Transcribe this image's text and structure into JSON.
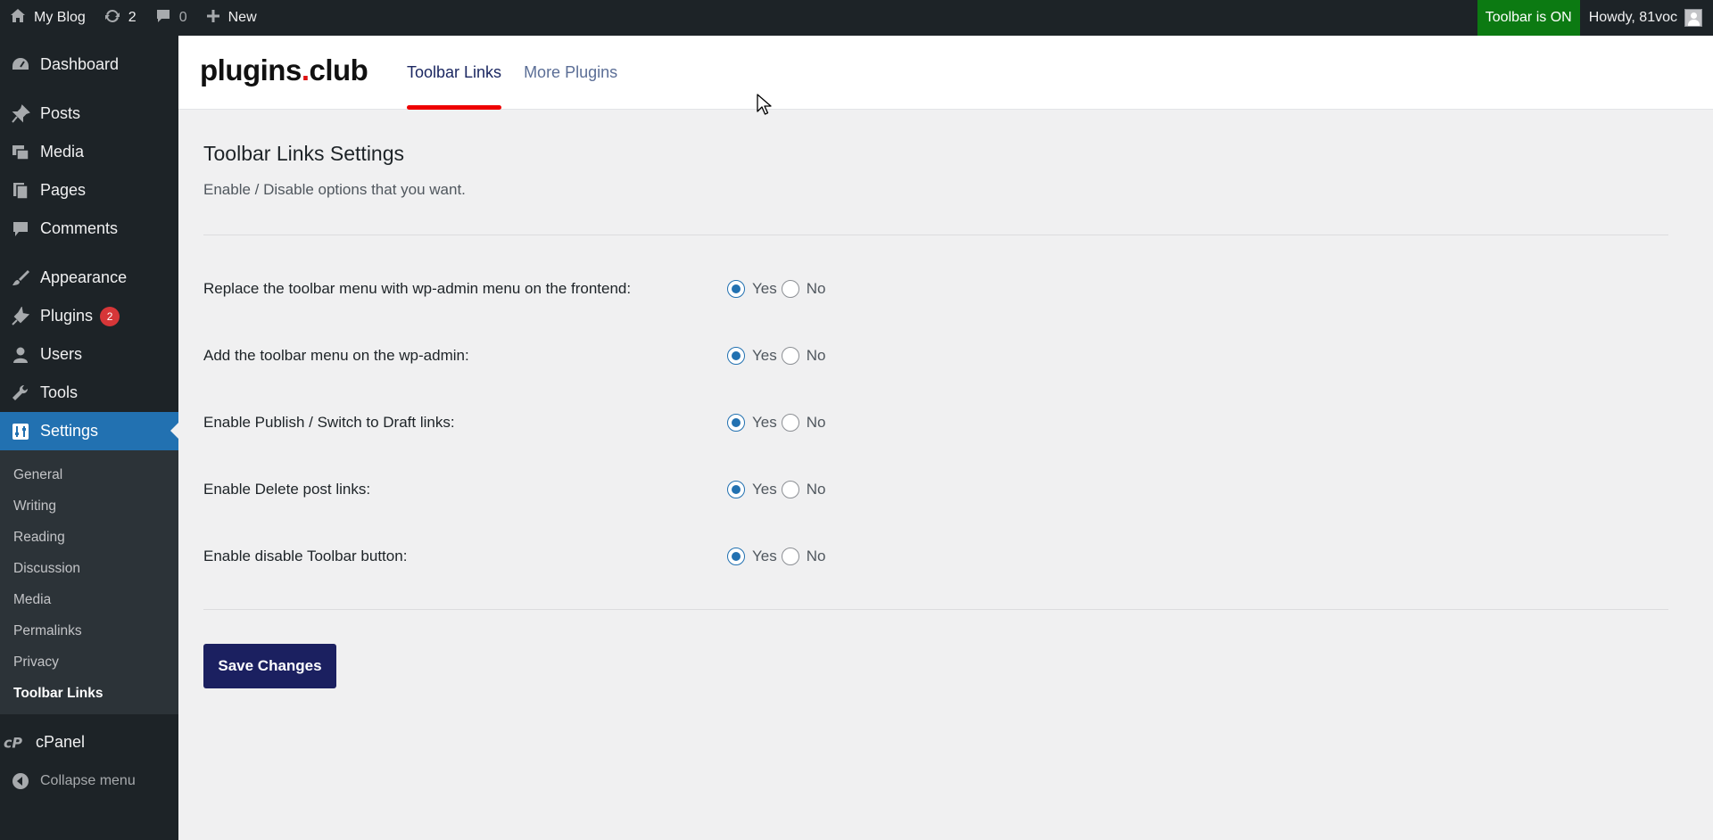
{
  "adminbar": {
    "site_name": "My Blog",
    "updates_count": "2",
    "comments_count": "0",
    "new_label": "New",
    "toolbar_status": "Toolbar is ON",
    "howdy": "Howdy, 81voc",
    "colors": {
      "bg": "#1d2327",
      "toolbar_on": "#0c7a12"
    }
  },
  "sidebar": {
    "items": [
      {
        "label": "Dashboard",
        "icon": "dashboard-icon"
      },
      {
        "label": "Posts",
        "icon": "pin-icon"
      },
      {
        "label": "Media",
        "icon": "media-icon"
      },
      {
        "label": "Pages",
        "icon": "pages-icon"
      },
      {
        "label": "Comments",
        "icon": "comment-icon"
      },
      {
        "label": "Appearance",
        "icon": "brush-icon"
      },
      {
        "label": "Plugins",
        "icon": "plugin-icon",
        "badge": "2"
      },
      {
        "label": "Users",
        "icon": "user-icon"
      },
      {
        "label": "Tools",
        "icon": "wrench-icon"
      },
      {
        "label": "Settings",
        "icon": "settings-icon"
      }
    ],
    "submenu": [
      "General",
      "Writing",
      "Reading",
      "Discussion",
      "Media",
      "Permalinks",
      "Privacy",
      "Toolbar Links"
    ],
    "cpanel": "cPanel",
    "collapse": "Collapse menu",
    "colors": {
      "current": "#2271b1"
    }
  },
  "plugin_header": {
    "logo_text": "plugins",
    "logo_dot": ".",
    "logo_suffix": "club",
    "tabs": [
      {
        "label": "Toolbar Links"
      },
      {
        "label": "More Plugins"
      }
    ],
    "colors": {
      "accent": "#ee0000",
      "tab_active": "#1b2761"
    }
  },
  "settings": {
    "title": "Toolbar Links Settings",
    "subtitle": "Enable / Disable options that you want.",
    "yes_label": "Yes",
    "no_label": "No",
    "rows": [
      {
        "label": "Replace the toolbar menu with wp-admin menu on the frontend:",
        "value": "Yes"
      },
      {
        "label": "Add the toolbar menu on the wp-admin:",
        "value": "Yes"
      },
      {
        "label": "Enable Publish / Switch to Draft links:",
        "value": "Yes"
      },
      {
        "label": "Enable Delete post links:",
        "value": "Yes"
      },
      {
        "label": "Enable disable Toolbar button:",
        "value": "Yes"
      }
    ],
    "save_label": "Save Changes",
    "colors": {
      "save_btn": "#1b2060",
      "radio_checked": "#2271b1"
    }
  }
}
